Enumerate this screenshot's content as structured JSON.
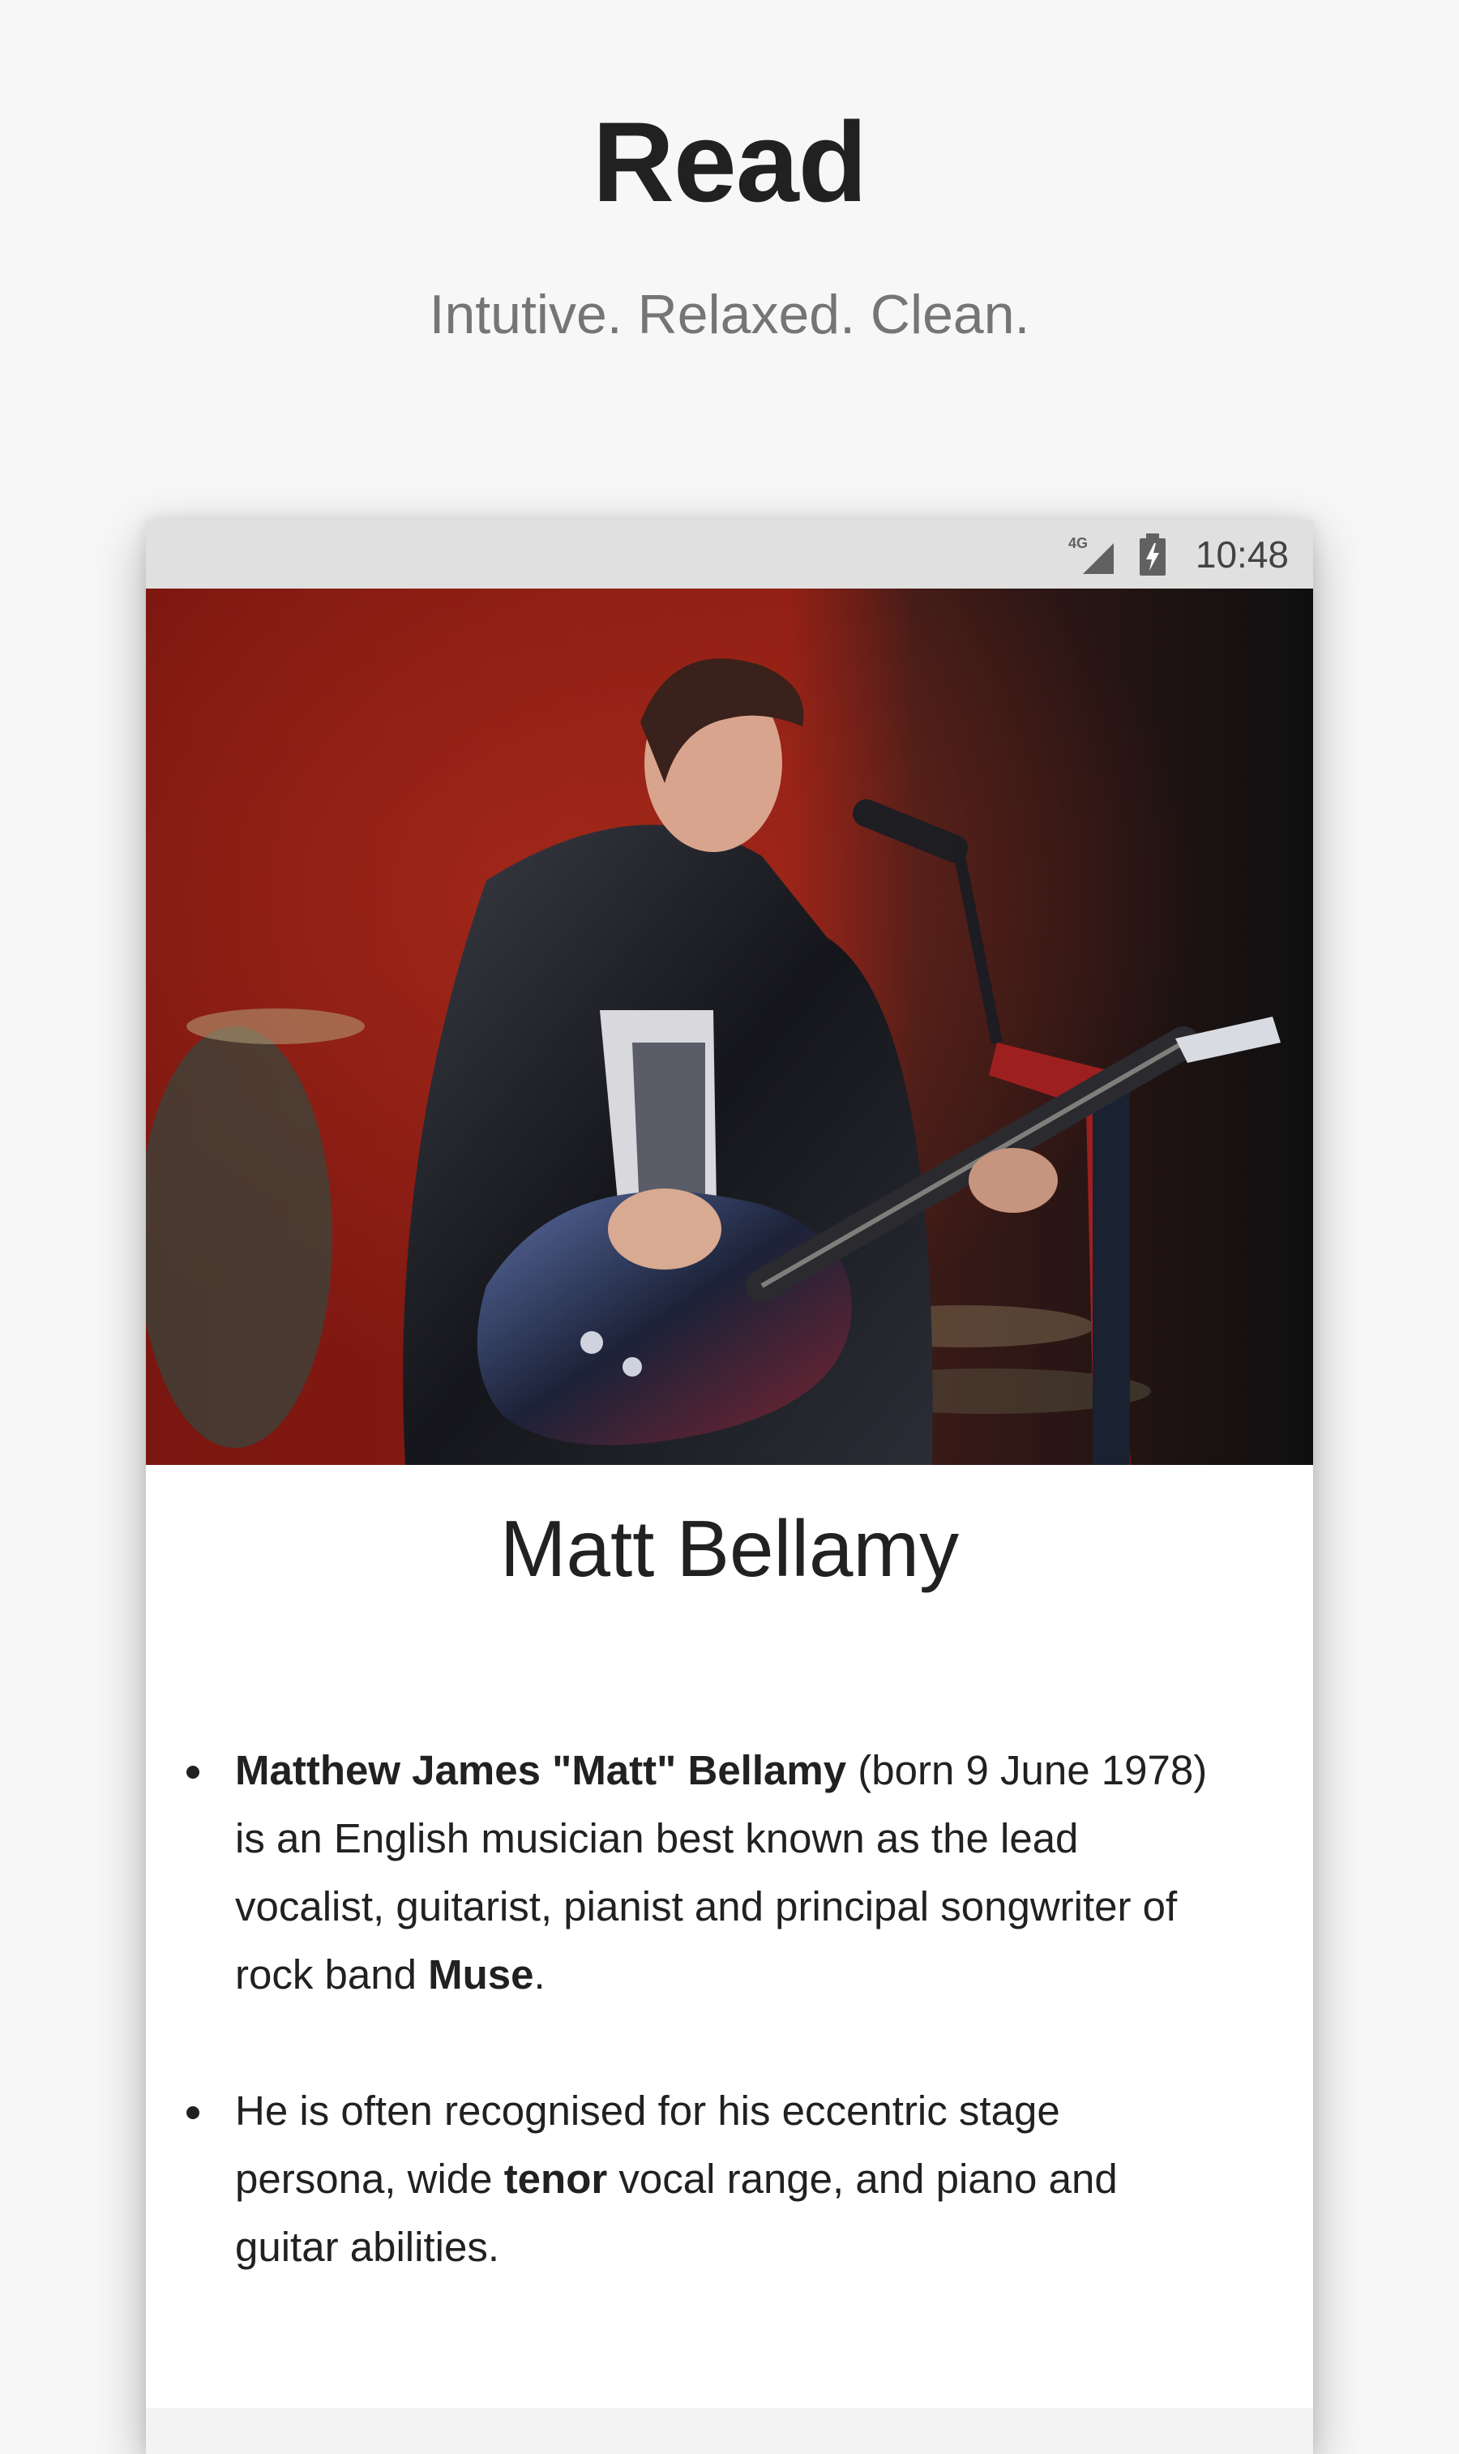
{
  "hero": {
    "title": "Read",
    "subtitle": "Intutive. Relaxed. Clean."
  },
  "status_bar": {
    "network": "4G",
    "time": "10:48",
    "signal_icon": "cellular-signal-icon",
    "battery_icon": "battery-charging-icon"
  },
  "article": {
    "image_name": "concert-photo",
    "title": "Matt Bellamy",
    "summary": [
      {
        "b1": "Matthew James \"Matt\" Bellamy",
        "t1": " (born 9 June 1978) is an English musician best known as the lead vocalist, guitarist, pianist and principal songwriter of rock band ",
        "b2": "Muse",
        "t2": "."
      },
      {
        "t1": "He is often recognised for his eccentric stage persona, wide ",
        "b1": "tenor",
        "t2": " vocal range, and piano and guitar abilities."
      }
    ]
  }
}
